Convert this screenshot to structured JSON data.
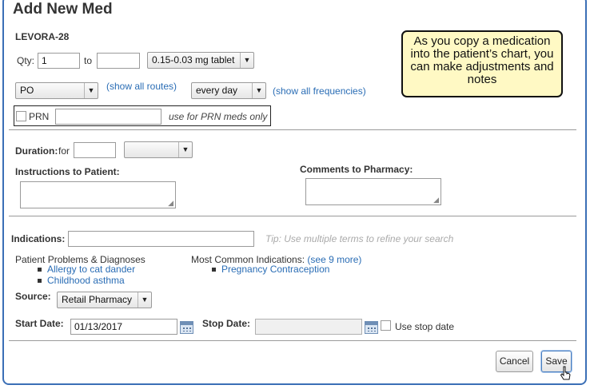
{
  "dialog": {
    "title": "Add New Med"
  },
  "med": {
    "name": "LEVORA-28"
  },
  "qty": {
    "label": "Qty:",
    "from_value": "1",
    "to_label": "to",
    "to_value": "",
    "unit": "0.15-0.03 mg tablet"
  },
  "route": {
    "value": "PO",
    "show_all_link": "(show all routes)"
  },
  "frequency": {
    "value": "every day",
    "show_all_link": "(show all frequencies)"
  },
  "prn": {
    "label": "PRN",
    "value": "",
    "hint": "use for PRN meds only"
  },
  "callout": {
    "text": "As you copy a medication into the patient’s chart, you can make adjustments and notes"
  },
  "duration": {
    "label": "Duration:",
    "for_label": "for",
    "value": "",
    "unit": ""
  },
  "instructions": {
    "label": "Instructions to Patient:",
    "value": ""
  },
  "comments": {
    "label": "Comments to Pharmacy:",
    "value": ""
  },
  "indications": {
    "label": "Indications:",
    "value": "",
    "tip": "Tip: Use multiple terms to refine your search",
    "problems_heading": "Patient Problems & Diagnoses",
    "problems": [
      "Allergy to cat dander",
      "Childhood asthma"
    ],
    "common_heading": "Most Common Indications:",
    "see_more": "(see 9 more)",
    "common": [
      "Pregnancy Contraception"
    ]
  },
  "source": {
    "label": "Source:",
    "value": "Retail Pharmacy"
  },
  "dates": {
    "start_label": "Start Date:",
    "start_value": "01/13/2017",
    "stop_label": "Stop Date:",
    "stop_value": "",
    "use_stop_label": "Use stop date"
  },
  "buttons": {
    "cancel": "Cancel",
    "save": "Save"
  },
  "icons": {
    "calendar": "calendar-icon",
    "dropdown": "chevron-down-icon",
    "cursor": "pointer-cursor-icon"
  },
  "colors": {
    "frame": "#3b6fb6",
    "link": "#2a6db5",
    "callout_bg": "#fff9c4"
  }
}
